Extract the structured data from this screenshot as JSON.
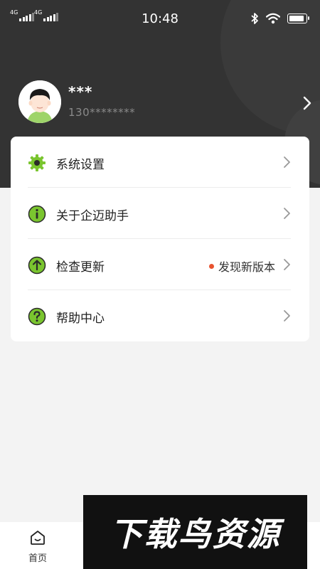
{
  "status_bar": {
    "time": "10:48",
    "network_1": "4G",
    "network_2": "4G"
  },
  "profile": {
    "name": "***",
    "phone": "130********"
  },
  "menu": {
    "items": [
      {
        "label": "系统设置",
        "icon": "gear-icon"
      },
      {
        "label": "关于企迈助手",
        "icon": "info-icon"
      },
      {
        "label": "检查更新",
        "icon": "upgrade-icon",
        "extra": "发现新版本"
      },
      {
        "label": "帮助中心",
        "icon": "help-icon"
      }
    ]
  },
  "bottom_nav": {
    "home_label": "首页"
  },
  "watermark": {
    "text": "下载鸟资源"
  },
  "colors": {
    "header_bg": "#333333",
    "accent_green": "#7ac52f",
    "update_dot": "#e8532f"
  }
}
